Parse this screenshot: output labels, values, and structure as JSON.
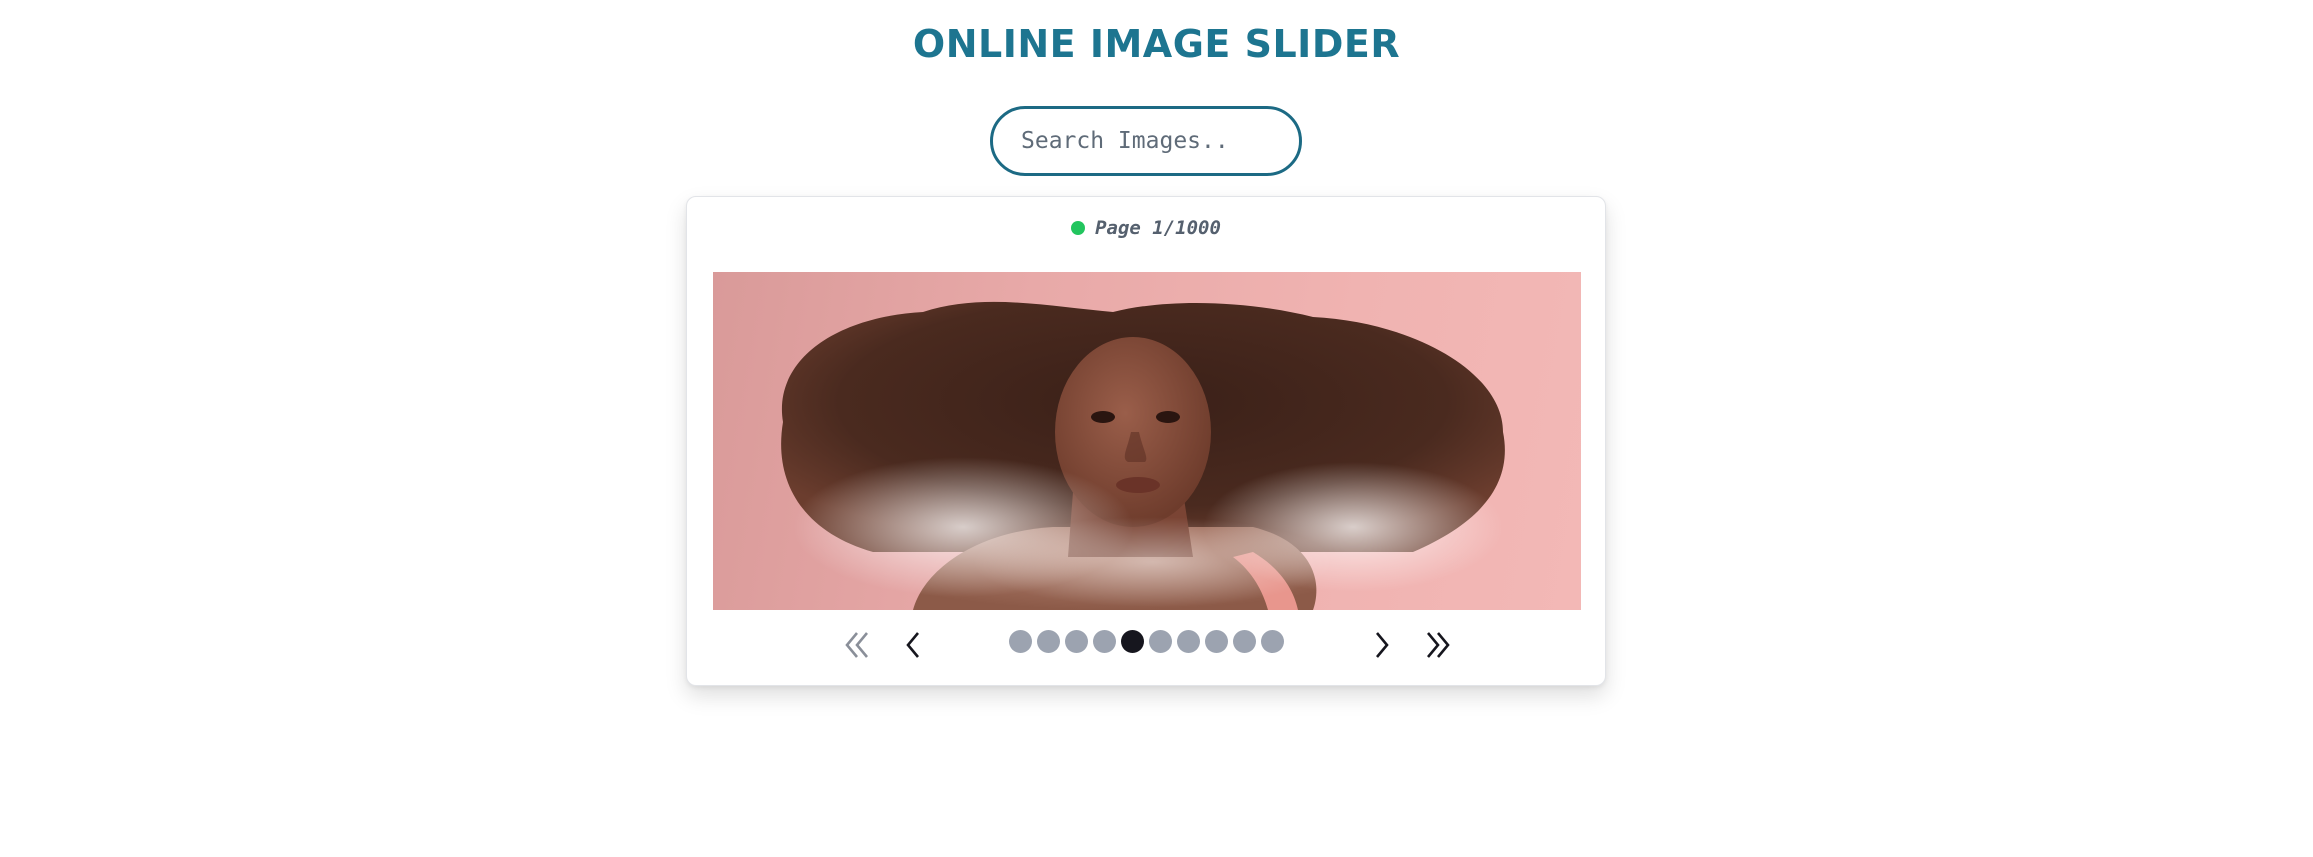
{
  "header": {
    "title": "ONLINE IMAGE SLIDER"
  },
  "search": {
    "placeholder": "Search Images..",
    "value": ""
  },
  "slider": {
    "status_color": "#22c55e",
    "page_label": "Page 1/1000",
    "image": {
      "subject": "portrait of a woman with voluminous curly hair against a pink background"
    },
    "controls": {
      "first_icon": "double-chevron-left-icon",
      "prev_icon": "chevron-left-icon",
      "next_icon": "chevron-right-icon",
      "last_icon": "double-chevron-right-icon",
      "dot_count": 10,
      "active_dot": 5
    }
  },
  "colors": {
    "accent": "#1d7590",
    "search_border": "#1c6a84",
    "dot_inactive": "#9ca3b0",
    "dot_active": "#16161e"
  }
}
